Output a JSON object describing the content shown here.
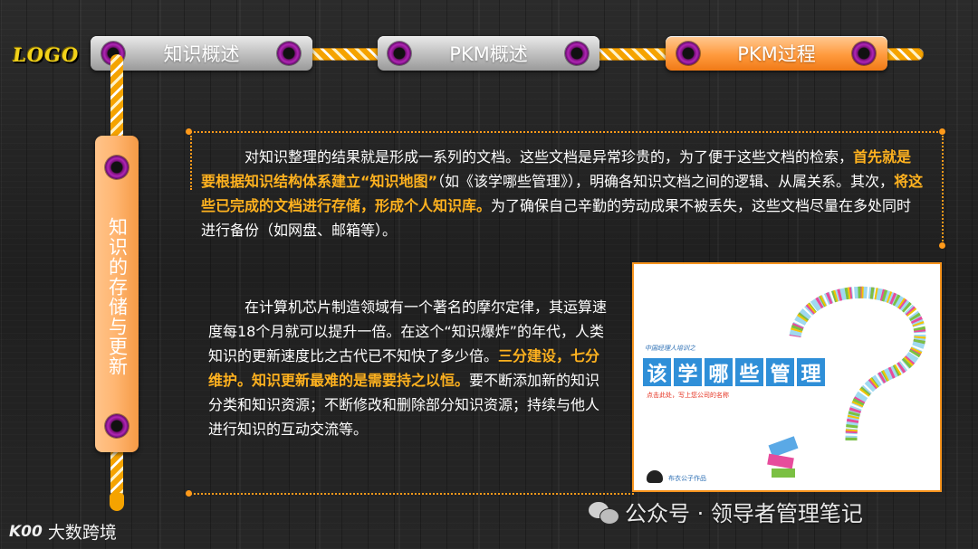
{
  "logo": "LOGO",
  "nav": {
    "tabs": [
      {
        "label": "知识概述",
        "active": false
      },
      {
        "label": "PKM概述",
        "active": false
      },
      {
        "label": "PKM过程",
        "active": true
      }
    ]
  },
  "section": {
    "title": "知识的存储与更新"
  },
  "content": {
    "p1": {
      "a": "对知识整理的结果就是形成一系列的文档。这些文档是异常珍贵的，为了便于这些文档的检索，",
      "b": "首先就是要根据知识结构体系建立“知识地图”",
      "c": "（如《该学哪些管理》），明确各知识文档之间的逻辑、从属关系。其次，",
      "d": "将这些已完成的文档进行存储，形成个人知识库。",
      "e": "为了确保自己辛勤的劳动成果不被丢失，这些文档尽量在多处同时进行备份（如网盘、邮箱等）。"
    },
    "p2": {
      "a": "在计算机芯片制造领域有一个著名的摩尔定律，其运算速度每18个月就可以提升一倍。在这个“知识爆炸”的年代，人类知识的更新速度比之古代已不知快了多少倍。",
      "b": "三分建设，七分维护。知识更新最难的是需要持之以恒。",
      "c": "要不断添加新的知识分类和知识资源；不断修改和删除部分知识资源；持续与他人进行知识的互动交流等。"
    }
  },
  "book": {
    "subtitle": "中国经理人培训之",
    "title_chars": [
      "该",
      "学",
      "哪",
      "些",
      "管",
      "理"
    ],
    "note": "点击此处，写上您公司的名称",
    "author": "布衣公子作品"
  },
  "watermark": {
    "wechat": "公众号 · 领导者管理笔记",
    "brand": "大数跨境",
    "brand_icon": "K00"
  },
  "colors": {
    "accent": "#ffb21f",
    "rope": "#f5a300",
    "tab_active": "#ff9a3d",
    "frame_dots": "#ff9a1a"
  }
}
